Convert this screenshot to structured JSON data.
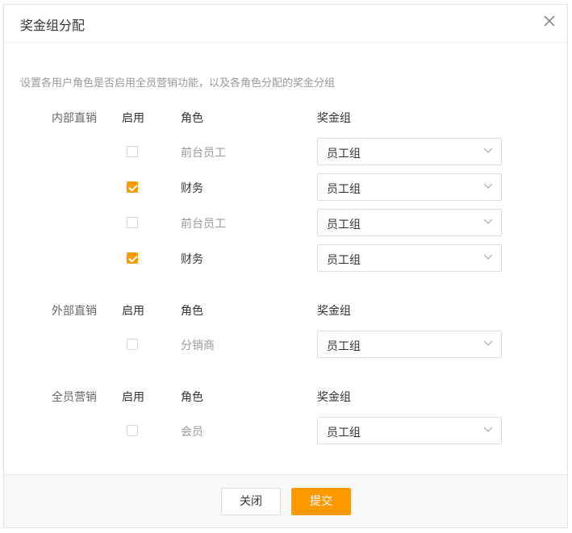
{
  "dialog": {
    "title": "奖金组分配",
    "description": "设置各用户角色是否启用全员营销功能，以及各角色分配的奖金分组"
  },
  "columns": {
    "enable": "启用",
    "role": "角色",
    "bonus": "奖金组"
  },
  "groups": [
    {
      "name": "内部直销",
      "rows": [
        {
          "role": "前台员工",
          "enabled": false,
          "bonus_group": "员工组"
        },
        {
          "role": "财务",
          "enabled": true,
          "bonus_group": "员工组"
        },
        {
          "role": "前台员工",
          "enabled": false,
          "bonus_group": "员工组"
        },
        {
          "role": "财务",
          "enabled": true,
          "bonus_group": "员工组"
        }
      ]
    },
    {
      "name": "外部直销",
      "rows": [
        {
          "role": "分销商",
          "enabled": false,
          "bonus_group": "员工组"
        }
      ]
    },
    {
      "name": "全员营销",
      "rows": [
        {
          "role": "会员",
          "enabled": false,
          "bonus_group": "员工组"
        }
      ]
    }
  ],
  "footer": {
    "close_label": "关闭",
    "submit_label": "提交"
  },
  "colors": {
    "accent": "#ff9900",
    "muted_text": "#999999",
    "footer_bg": "#f7f8fa"
  },
  "icons": {
    "close": "close-icon",
    "dropdown": "chevron-down-icon",
    "checkbox_checked": "checkmark-icon"
  }
}
